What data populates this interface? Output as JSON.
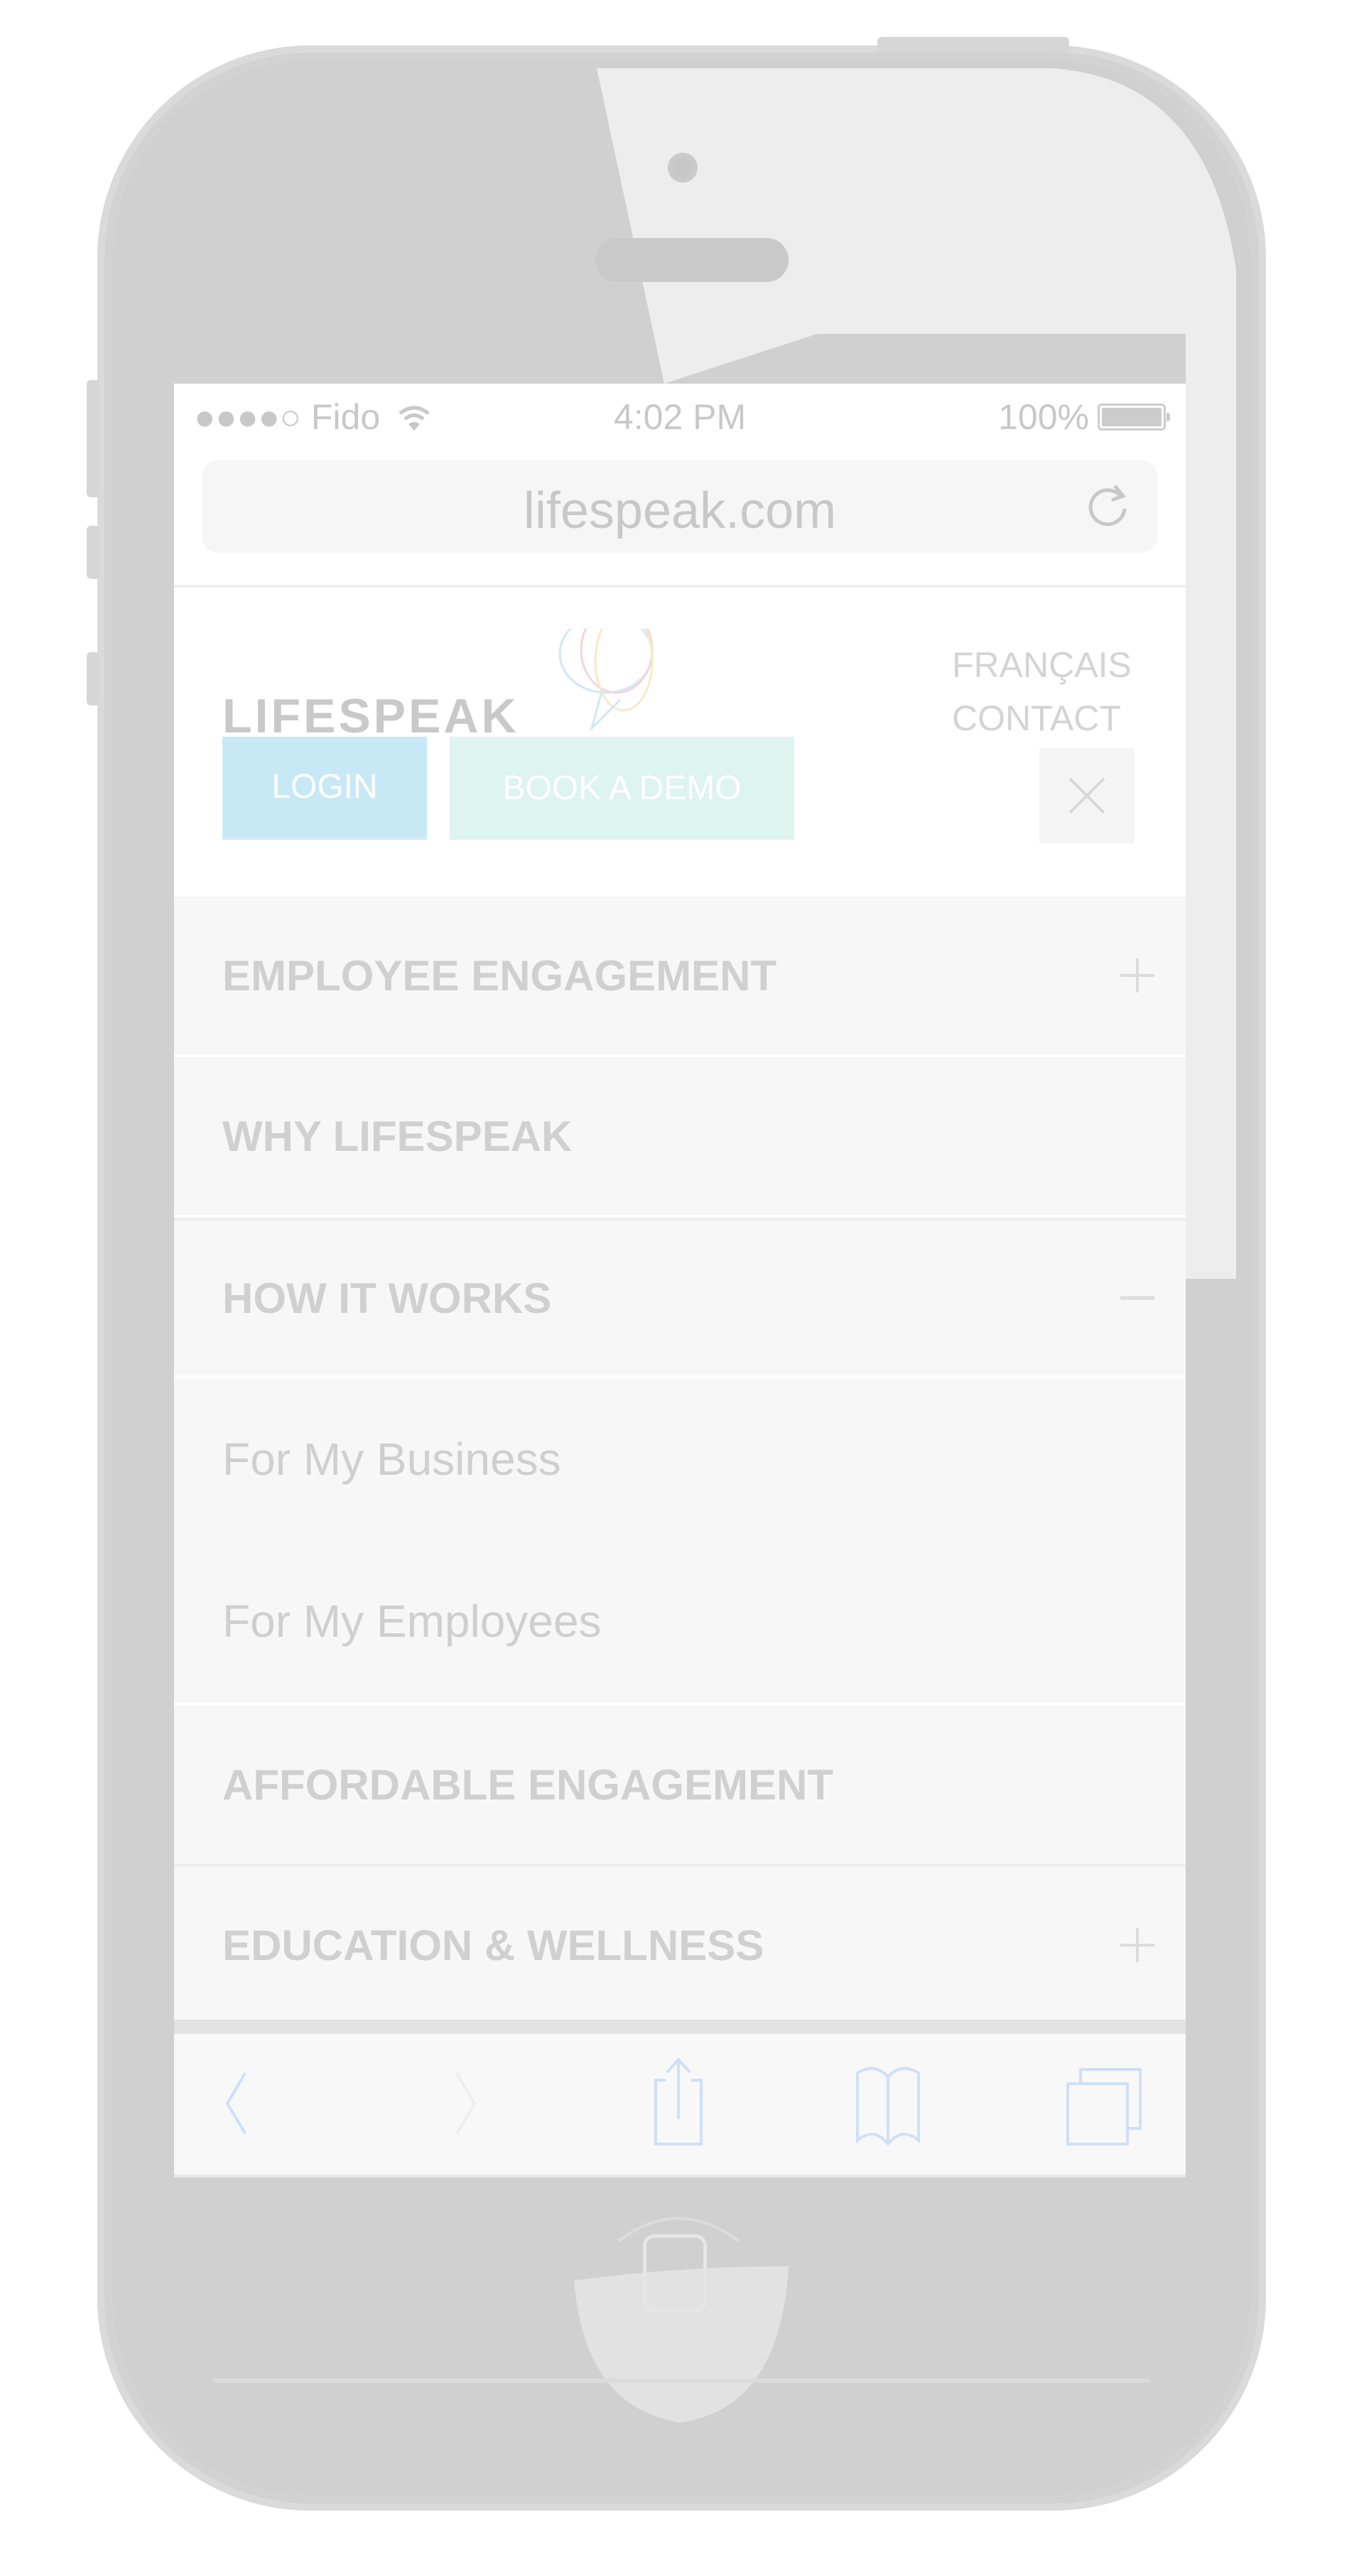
{
  "device": {
    "status_bar": {
      "carrier": "●●●●○ Fido",
      "time": "4:02 PM",
      "battery": "100%"
    },
    "browser": {
      "url": "lifespeak.com"
    }
  },
  "header": {
    "logo_text": "LIFESPEAK",
    "language_link": "FRANÇAIS",
    "contact_link": "CONTACT",
    "login_button": "LOGIN",
    "demo_button": "BOOK A DEMO",
    "close_icon": "close-icon"
  },
  "menu": {
    "items": [
      {
        "label": "EMPLOYEE ENGAGEMENT",
        "toggle": "+",
        "expanded": false
      },
      {
        "label": "WHY LIFESPEAK",
        "toggle": "",
        "expanded": false
      },
      {
        "label": "HOW IT WORKS",
        "toggle": "−",
        "expanded": true,
        "children": [
          {
            "label": "For My Business"
          },
          {
            "label": "For My Employees"
          }
        ]
      },
      {
        "label": "AFFORDABLE ENGAGEMENT",
        "toggle": "",
        "expanded": false
      },
      {
        "label": "EDUCATION & WELLNESS",
        "toggle": "+",
        "expanded": false
      }
    ]
  },
  "toolbar": {
    "icons": [
      "back-icon",
      "forward-icon",
      "share-icon",
      "bookmarks-icon",
      "tabs-icon"
    ]
  },
  "colors": {
    "login": "#c7e9f5",
    "demo": "#def4ee",
    "toolbar_icon": "#cfe0f6",
    "menu_bg": "#f7f7f7",
    "phone": "#d0d0d0"
  }
}
